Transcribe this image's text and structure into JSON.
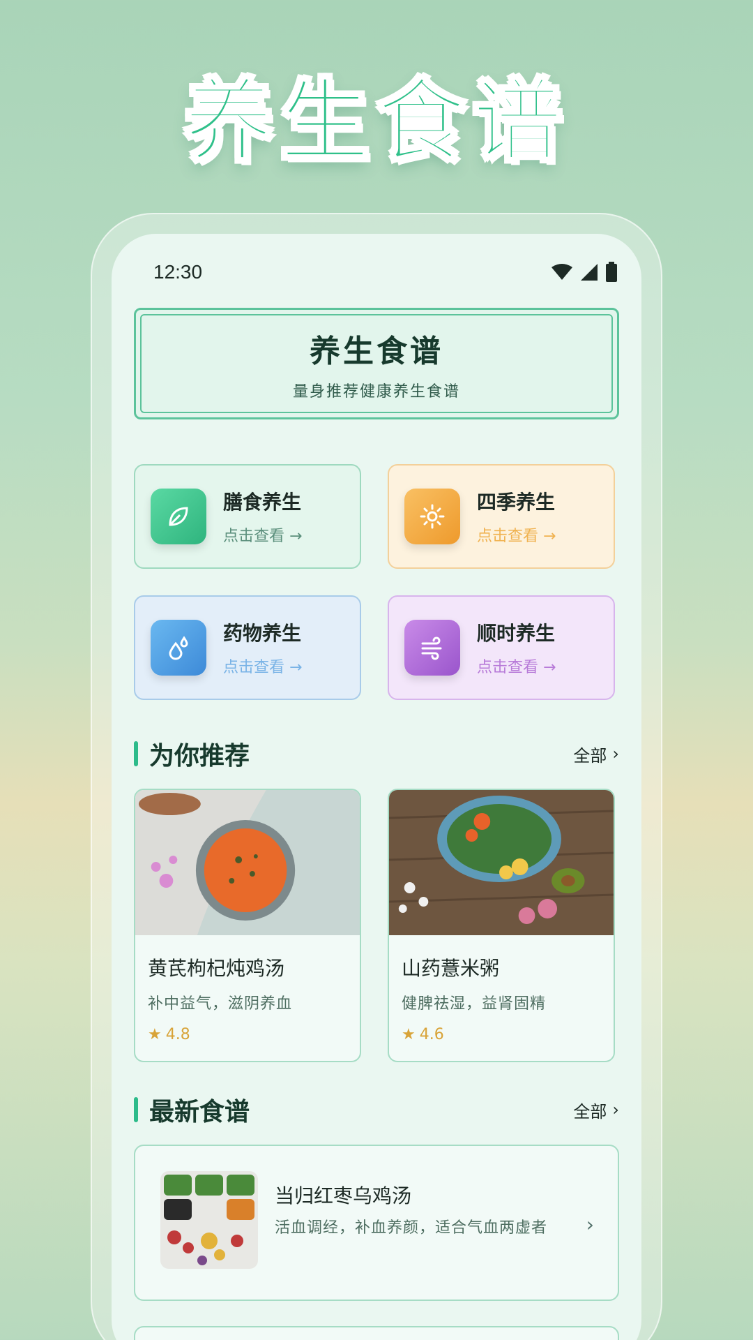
{
  "promo": {
    "title": "养生食谱"
  },
  "status_bar": {
    "time": "12:30"
  },
  "header": {
    "title": "养生食谱",
    "subtitle": "量身推荐健康养生食谱"
  },
  "categories": [
    {
      "name": "膳食养生",
      "link": "点击查看 →",
      "icon": "leaf-icon",
      "color": "#3cc48e"
    },
    {
      "name": "四季养生",
      "link": "点击查看 →",
      "icon": "sun-icon",
      "color": "#f3a53a"
    },
    {
      "name": "药物养生",
      "link": "点击查看 →",
      "icon": "drops-icon",
      "color": "#4a9fe0"
    },
    {
      "name": "顺时养生",
      "link": "点击查看 →",
      "icon": "wind-icon",
      "color": "#b06ad8"
    }
  ],
  "recommend": {
    "title": "为你推荐",
    "more": "全部",
    "items": [
      {
        "title": "黄芪枸杞炖鸡汤",
        "desc": "补中益气，滋阴养血",
        "rating": "4.8"
      },
      {
        "title": "山药薏米粥",
        "desc": "健脾祛湿，益肾固精",
        "rating": "4.6"
      }
    ]
  },
  "latest": {
    "title": "最新食谱",
    "more": "全部",
    "items": [
      {
        "title": "当归红枣乌鸡汤",
        "desc": "活血调经，补血养颜，适合气血两虚者"
      }
    ]
  }
}
